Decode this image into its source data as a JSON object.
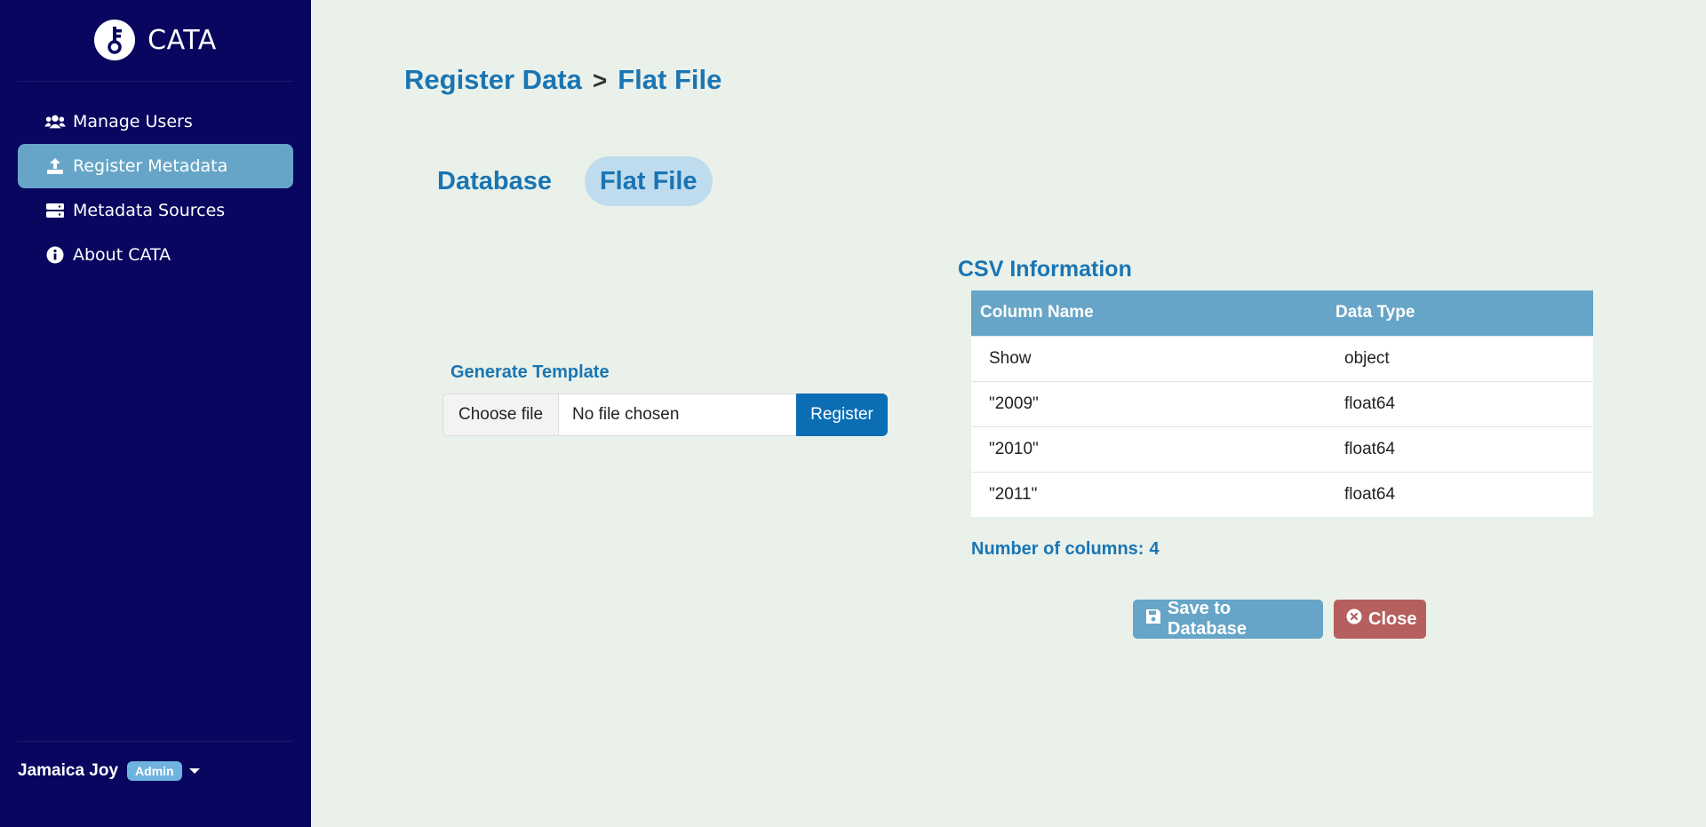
{
  "brand": {
    "name": "CATA",
    "logo_icon": "key-logo-icon"
  },
  "sidebar": {
    "items": [
      {
        "label": "Manage Users",
        "icon": "users-icon",
        "active": false
      },
      {
        "label": "Register Metadata",
        "icon": "upload-icon",
        "active": true
      },
      {
        "label": "Metadata Sources",
        "icon": "server-icon",
        "active": false
      },
      {
        "label": "About CATA",
        "icon": "info-icon",
        "active": false
      }
    ],
    "user": {
      "name": "Jamaica Joy",
      "role": "Admin"
    }
  },
  "breadcrumb": {
    "parent": "Register Data",
    "separator": ">",
    "current": "Flat File"
  },
  "tabs": [
    {
      "label": "Database",
      "active": false
    },
    {
      "label": "Flat File",
      "active": true
    }
  ],
  "upload": {
    "label": "Generate Template",
    "choose_label": "Choose file",
    "status": "No file chosen",
    "register_label": "Register"
  },
  "csv": {
    "title": "CSV Information",
    "headers": [
      "Column Name",
      "Data Type"
    ],
    "rows": [
      [
        "Show",
        "object"
      ],
      [
        "\"2009\"",
        "float64"
      ],
      [
        "\"2010\"",
        "float64"
      ],
      [
        "\"2011\"",
        "float64"
      ]
    ],
    "count_label": "Number of columns:",
    "count_value": "4"
  },
  "actions": {
    "save_label": "Save to Database",
    "close_label": "Close"
  },
  "colors": {
    "sidebar": "#08065e",
    "accent": "#1a75b3",
    "active": "#66a5c7",
    "danger": "#b65f5f",
    "background": "#eaf1ea"
  }
}
